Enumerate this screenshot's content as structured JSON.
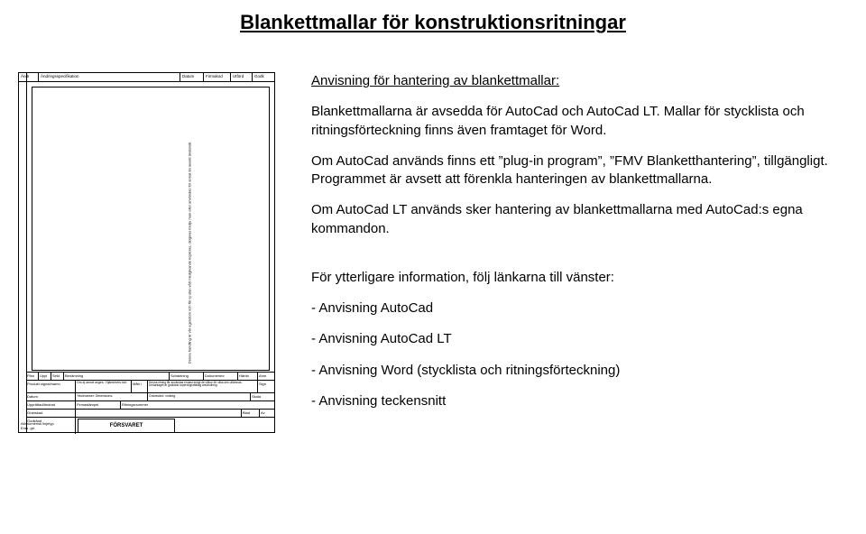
{
  "title": "Blankettmallar för konstruktionsritningar",
  "subheading": "Anvisning för hantering av blankettmallar:",
  "paragraphs": {
    "p1": "Blankettmallarna är avsedda för AutoCad och AutoCad LT. Mallar för stycklista och ritningsförteckning finns även framtaget för Word.",
    "p2": "Om AutoCad används finns ett ”plug-in program”, ”FMV Blanketthantering”, tillgängligt. Programmet är avsett att förenkla hanteringen av blankettmallarna.",
    "p3": "Om AutoCad LT används sker hantering av blankettmallarna med AutoCad:s egna kommandon.",
    "p4": "För ytterligare information, följ länkarna till vänster:"
  },
  "list": {
    "i0": "Anvisning AutoCad",
    "i1": "Anvisning AutoCad LT",
    "i2": "Anvisning Word (stycklista och ritningsförteckning)",
    "i3": "Anvisning teckensnitt"
  },
  "template": {
    "top": {
      "c0": "Ändr",
      "c1": "Ändringsspecifikation",
      "c2": "Datum",
      "c3": "Firmakod",
      "c4": "Utförd",
      "c5": "Godk"
    },
    "left_rotated": "Denna handling är vår egendom och får ej utan vårt medgivande kopieras, delgivas tredje man eller användas för annat än avsett ändamål.",
    "tb": {
      "r0_c0": "Plan",
      "r0_c1": "Uppl",
      "r0_c2": "Sekt",
      "r0_c3": "Benämning",
      "r0_c4": "Schaktning",
      "r0_c5": "Dokumentnr",
      "r0_c6": "Härdn",
      "r0_c7": "Anm",
      "r1_c0": "Produkt signat/namn",
      "r1_c1": "Om ej annat anges:",
      "r1_c2": "Mått i",
      "r1_c3": "Ytjämnhets std:",
      "r1_c4": "Denna ritning får användas endast enligt de villkor för vilka den utlämnas.",
      "r1_c5": "Undantaget är godkänd kopieringsrättslig användning.",
      "r1_c6": "Sign",
      "r2_c0": "Datum",
      "r2_c1": "Yttoleranser: Dimensions-",
      "r2_c2": "Gränsvärd. vinkelg.",
      "r2_c3": "Skala",
      "r3_c0": "Upprättad/ändrad",
      "r3_c1": "Firmastämpel",
      "r3_c2": "Ritningsnummer",
      "r4_c0": "Granskad",
      "r4_c1": "Blad",
      "r4_c2": "Av",
      "r5_c0": "Godkänd",
      "r5_c1": "FÖRSVARET",
      "foot_a": "Alfanumerisk linjetyp",
      "foot_b": "Eras .gd"
    }
  }
}
